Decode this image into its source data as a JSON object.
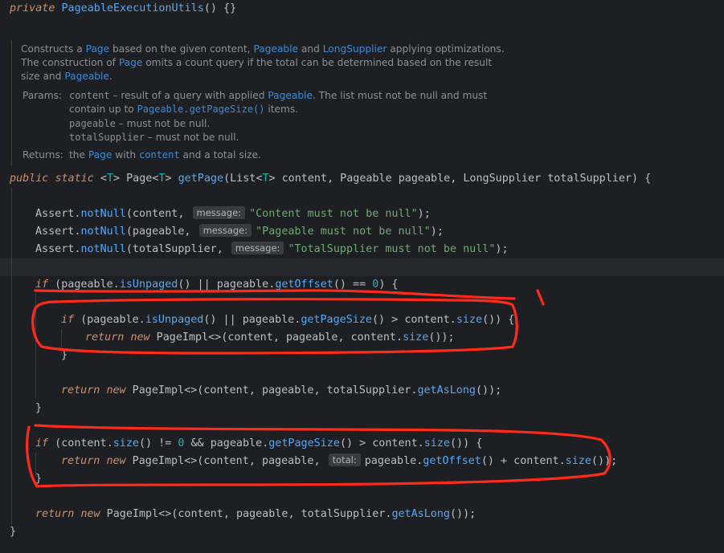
{
  "code": {
    "line_ctor": {
      "kw": "private",
      "name": "PageableExecutionUtils",
      "rest": "() {}"
    },
    "doc": {
      "l1a": "Constructs a ",
      "l1b": "Page",
      "l1c": " based on the given content, ",
      "l1d": "Pageable",
      "l1e": " and ",
      "l1f": "LongSupplier",
      "l1g": " applying optimizations.",
      "l2a": "The construction of ",
      "l2b": "Page",
      "l2c": " omits a count query if the total can be determined based on the result",
      "l3a": "size and ",
      "l3b": "Pageable",
      "l3c": ".",
      "params_label": "Params:",
      "p1a": "content",
      "p1b": " – result of a query with applied ",
      "p1c": "Pageable",
      "p1d": ". The list must not be null and must",
      "p1e": "contain up to ",
      "p1f": "Pageable.getPageSize()",
      "p1g": " items.",
      "p2a": "pageable",
      "p2b": " – must not be null.",
      "p3a": "totalSupplier",
      "p3b": " – must not be null.",
      "returns_label": "Returns:",
      "r1a": "the ",
      "r1b": "Page",
      "r1c": " with ",
      "r1d": "content",
      "r1e": " and a total size."
    },
    "sig": {
      "kw1": "public",
      "kw2": "static",
      "t1": "<",
      "T1": "T",
      "t2": "> Page<",
      "T2": "T",
      "t3": "> ",
      "name": "getPage",
      "p1": "(List<",
      "T3": "T",
      "p2": "> ",
      "a1": "content",
      "p3": ", Pageable ",
      "a2": "pageable",
      "p4": ", LongSupplier ",
      "a3": "totalSupplier",
      "p5": ") {"
    },
    "assert1": {
      "cls": "Assert",
      "dot": ".",
      "fn": "notNull",
      "open": "(content, ",
      "hint": "message:",
      "str": "\"Content must not be null\"",
      "close": ");"
    },
    "assert2": {
      "cls": "Assert",
      "dot": ".",
      "fn": "notNull",
      "open": "(pageable, ",
      "hint": "message:",
      "str": "\"Pageable must not be null\"",
      "close": ");"
    },
    "assert3": {
      "cls": "Assert",
      "dot": ".",
      "fn": "notNull",
      "open": "(totalSupplier, ",
      "hint": "message:",
      "str": "\"TotalSupplier must not be null\"",
      "close": ");"
    },
    "if1": {
      "kw": "if",
      "a": " (",
      "v1": "pageable",
      "d1": ".",
      "f1": "isUnpaged",
      "b": "() || ",
      "v2": "pageable",
      "d2": ".",
      "f2": "getOffset",
      "c": "() == ",
      "n": "0",
      "e": ") {"
    },
    "if2": {
      "kw": "if",
      "a": " (",
      "v1": "pageable",
      "d1": ".",
      "f1": "isUnpaged",
      "b": "() || ",
      "v2": "pageable",
      "d2": ".",
      "f2": "getPageSize",
      "c": "() > ",
      "v3": "content",
      "d3": ".",
      "f3": "size",
      "e": "()) {"
    },
    "ret1": {
      "kw1": "return",
      "kw2": "new",
      "a": " PageImpl<>(",
      "v1": "content",
      "b": ", ",
      "v2": "pageable",
      "c": ", ",
      "v3": "content",
      "d": ".",
      "f": "size",
      "e": "());"
    },
    "brace_close": "}",
    "ret2": {
      "kw1": "return",
      "kw2": "new",
      "a": " PageImpl<>(",
      "v1": "content",
      "b": ", ",
      "v2": "pageable",
      "c": ", ",
      "v3": "totalSupplier",
      "d": ".",
      "f": "getAsLong",
      "e": "());"
    },
    "if3": {
      "kw": "if",
      "a": " (",
      "v1": "content",
      "d1": ".",
      "f1": "size",
      "b": "() != ",
      "n": "0",
      "c": " && ",
      "v2": "pageable",
      "d2": ".",
      "f2": "getPageSize",
      "e1": "() > ",
      "v3": "content",
      "d3": ".",
      "f3": "size",
      "e": "()) {"
    },
    "ret3": {
      "kw1": "return",
      "kw2": "new",
      "a": " PageImpl<>(",
      "v1": "content",
      "b": ", ",
      "v2": "pageable",
      "c": ", ",
      "hint": "total:",
      "v3": "pageable",
      "d1": ".",
      "f1": "getOffset",
      "e1": "() + ",
      "v4": "content",
      "d2": ".",
      "f2": "size",
      "e": "());"
    },
    "ret4": {
      "kw1": "return",
      "kw2": "new",
      "a": " PageImpl<>(",
      "v1": "content",
      "b": ", ",
      "v2": "pageable",
      "c": ", ",
      "v3": "totalSupplier",
      "d": ".",
      "f": "getAsLong",
      "e": "());"
    }
  },
  "colors": {
    "background": "#1e1f22",
    "keyword": "#cf8e6d",
    "method": "#56a8f5",
    "string": "#6aab73",
    "number": "#2aacb8",
    "param": "#c77dbb",
    "annotation_marker": "#ff2a1a"
  }
}
